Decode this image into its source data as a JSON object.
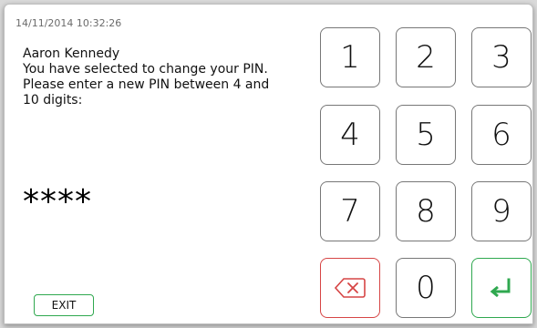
{
  "timestamp": "14/11/2014 10:32:26",
  "message": {
    "user_name": "Aaron Kennedy",
    "line1": "You have selected to change your PIN.",
    "line2": "Please enter a new PIN between 4 and",
    "line3": "10 digits:"
  },
  "pin_mask": "****",
  "exit_label": "EXIT",
  "keypad": {
    "keys": [
      "1",
      "2",
      "3",
      "4",
      "5",
      "6",
      "7",
      "8",
      "9",
      "0"
    ],
    "backspace_icon": "backspace-icon",
    "enter_icon": "enter-icon"
  },
  "colors": {
    "accent_green": "#2fa84f",
    "backspace_red": "#d64545"
  }
}
